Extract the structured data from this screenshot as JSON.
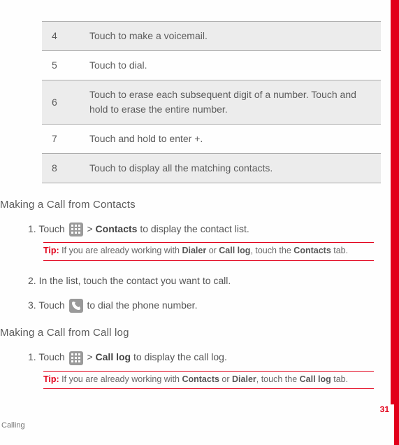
{
  "table": {
    "rows": [
      {
        "num": "4",
        "desc": "Touch to make a voicemail."
      },
      {
        "num": "5",
        "desc": "Touch to dial."
      },
      {
        "num": "6",
        "desc": "Touch to erase each subsequent digit of a number. Touch and hold to erase the entire number."
      },
      {
        "num": "7",
        "desc": "Touch and hold to enter +."
      },
      {
        "num": "8",
        "desc": "Touch to display all the matching contacts."
      }
    ]
  },
  "section1": {
    "heading": "Making a Call from Contacts",
    "step1_a": "1. Touch ",
    "step1_b": " > ",
    "step1_bold": "Contacts",
    "step1_c": " to display the contact list.",
    "tip_label": "Tip:  ",
    "tip_a": "If you are already working with ",
    "tip_b1": "Dialer",
    "tip_or": " or ",
    "tip_b2": "Call log",
    "tip_c": ", touch the ",
    "tip_b3": "Contacts",
    "tip_d": " tab.",
    "step2": "2. In the list, touch the contact you want to call.",
    "step3_a": "3. Touch ",
    "step3_b": " to dial the phone number."
  },
  "section2": {
    "heading": "Making a Call from Call log",
    "step1_a": "1. Touch ",
    "step1_b": " > ",
    "step1_bold": "Call log",
    "step1_c": " to display the call log.",
    "tip_label": "Tip:  ",
    "tip_a": "If you are already working with ",
    "tip_b1": "Contacts",
    "tip_or": " or ",
    "tip_b2": "Dialer",
    "tip_c": ", touch the ",
    "tip_b3": "Call log",
    "tip_d": " tab."
  },
  "footer": "Calling",
  "page_number": "31"
}
